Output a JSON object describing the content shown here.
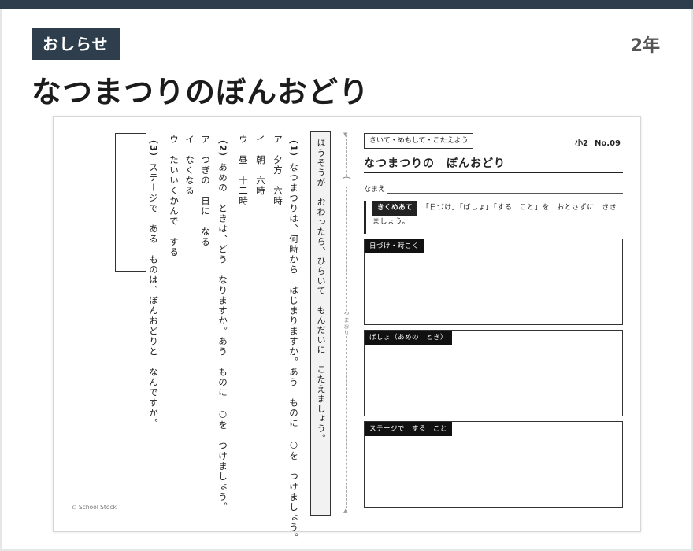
{
  "header": {
    "badge": "おしらせ",
    "grade": "2年",
    "title": "なつまつりのぼんおどり"
  },
  "worksheet": {
    "subtitle": "きいて・めもして・こたえよう",
    "level": "小2",
    "number": "No.09",
    "title": "なつまつりの　ぼんおどり",
    "name_label": "なまえ",
    "prompt_tag": "きくめあて",
    "prompt_text": "「日づけ」「ばしょ」「する　こと」を　おとさずに　ききましょう。",
    "fields": [
      {
        "label": "日づけ・時こく"
      },
      {
        "label": "ばしょ（あめの　とき）"
      },
      {
        "label": "ステージで　する　こと"
      }
    ],
    "instruction": "ほうそうが　おわったら、ひらいて　もんだいに　こたえましょう。",
    "fold_label": "やまおり",
    "copyright": "© School Stock"
  },
  "questions": {
    "q1_num": "（1）",
    "q1_text": "なつまつりは、何時から　はじまりますか。あう　ものに　○を　つけましょう。",
    "q1_a": "ア　夕方　六時",
    "q1_i": "イ　朝　六時",
    "q1_u": "ウ　昼　十二時",
    "q2_num": "（2）",
    "q2_text": "あめの　ときは、どう　なりますか。あう　ものに　○を　つけましょう。",
    "q2_a": "ア　つぎの　日に　なる",
    "q2_i": "イ　なくなる",
    "q2_u": "ウ　たいいくかんで　する",
    "q3_num": "（3）",
    "q3_text": "ステージで　ある　ものは、ぼんおどりと　なんですか。"
  }
}
